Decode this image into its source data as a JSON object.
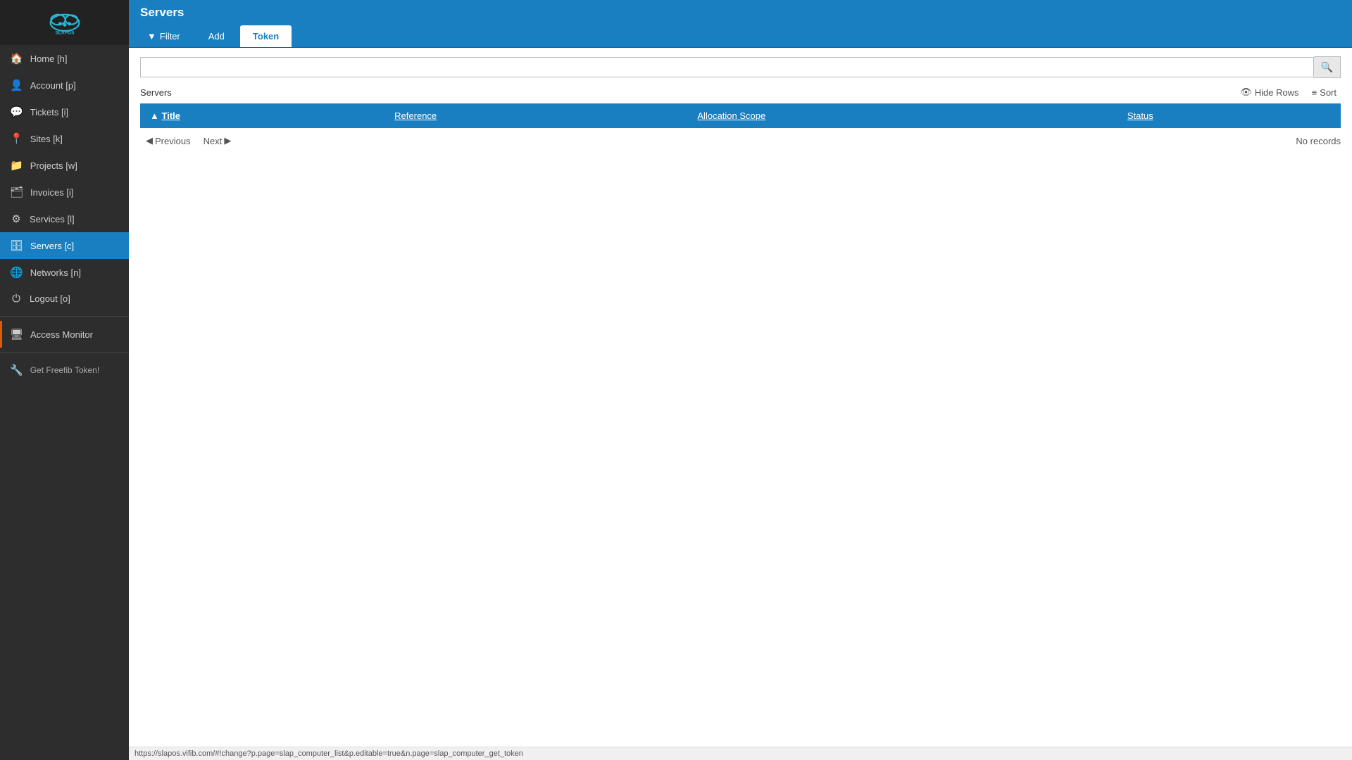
{
  "sidebar": {
    "logo_alt": "SlapOS logo",
    "items": [
      {
        "id": "home",
        "label": "Home [h]",
        "icon": "🏠",
        "active": false
      },
      {
        "id": "account",
        "label": "Account [p]",
        "icon": "👤",
        "active": false
      },
      {
        "id": "tickets",
        "label": "Tickets [i]",
        "icon": "💬",
        "active": false
      },
      {
        "id": "sites",
        "label": "Sites [k]",
        "icon": "📍",
        "active": false
      },
      {
        "id": "projects",
        "label": "Projects [w]",
        "icon": "📁",
        "active": false
      },
      {
        "id": "invoices",
        "label": "Invoices [i]",
        "icon": "🗂",
        "active": false
      },
      {
        "id": "services",
        "label": "Services [l]",
        "icon": "⚙",
        "active": false
      },
      {
        "id": "servers",
        "label": "Servers [c]",
        "icon": "🗄",
        "active": true
      },
      {
        "id": "networks",
        "label": "Networks [n]",
        "icon": "🌐",
        "active": false
      },
      {
        "id": "logout",
        "label": "Logout [o]",
        "icon": "⏻",
        "active": false
      }
    ],
    "access_monitor_label": "Access Monitor",
    "get_token_label": "Get Freefib Token!"
  },
  "header": {
    "title": "Servers"
  },
  "tabs": [
    {
      "id": "filter",
      "label": "Filter",
      "icon": "▼",
      "active": false
    },
    {
      "id": "add",
      "label": "Add",
      "icon": "",
      "active": false
    },
    {
      "id": "token",
      "label": "Token",
      "icon": "",
      "active": true
    }
  ],
  "search": {
    "placeholder": "",
    "value": ""
  },
  "table": {
    "label": "Servers",
    "hide_rows_label": "Hide Rows",
    "sort_label": "Sort",
    "columns": [
      {
        "id": "title",
        "label": "Title",
        "sorted": true
      },
      {
        "id": "reference",
        "label": "Reference",
        "sorted": false
      },
      {
        "id": "allocation_scope",
        "label": "Allocation Scope",
        "sorted": false
      },
      {
        "id": "status",
        "label": "Status",
        "sorted": false
      }
    ],
    "rows": [],
    "no_records_label": "No records"
  },
  "pagination": {
    "previous_label": "Previous",
    "next_label": "Next"
  },
  "status_bar": {
    "url": "https://slapos.vifib.com/#!change?p.page=slap_computer_list&p.editable=true&n.page=slap_computer_get_token"
  }
}
